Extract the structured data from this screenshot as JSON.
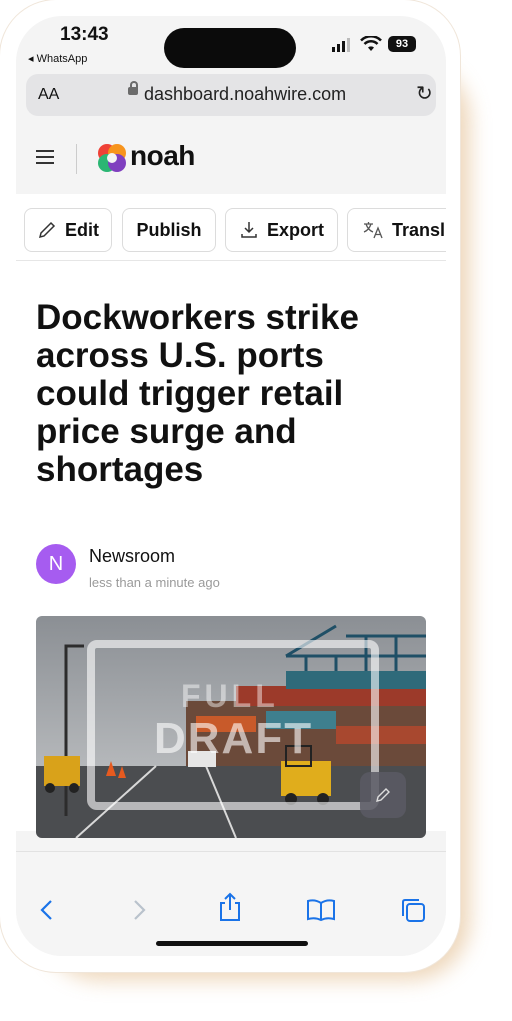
{
  "status_bar": {
    "time": "13:43",
    "back_app": "◂ WhatsApp",
    "battery": "93"
  },
  "address_bar": {
    "text_size_label": "AA",
    "url": "dashboard.noahwire.com"
  },
  "header": {
    "brand": "noah"
  },
  "toolbar": {
    "edit_label": "Edit",
    "publish_label": "Publish",
    "export_label": "Export",
    "translate_label": "Transl"
  },
  "article": {
    "headline": "Dockworkers strike across U.S. ports could trigger retail price surge and shortages",
    "author_initial": "N",
    "author": "Newsroom",
    "timestamp": "less than a minute ago",
    "image_overlay_top": "FULL",
    "image_overlay_bottom": "DRAFT"
  },
  "colors": {
    "avatar": "#a65cf0",
    "brand_accent": "#ef4136",
    "safari_blue": "#1a73e8"
  },
  "icons": [
    "hamburger-icon",
    "lock-icon",
    "reload-icon",
    "pencil-icon",
    "download-icon",
    "translate-icon",
    "back-icon",
    "forward-icon",
    "share-icon",
    "bookmarks-icon",
    "tabs-icon"
  ]
}
